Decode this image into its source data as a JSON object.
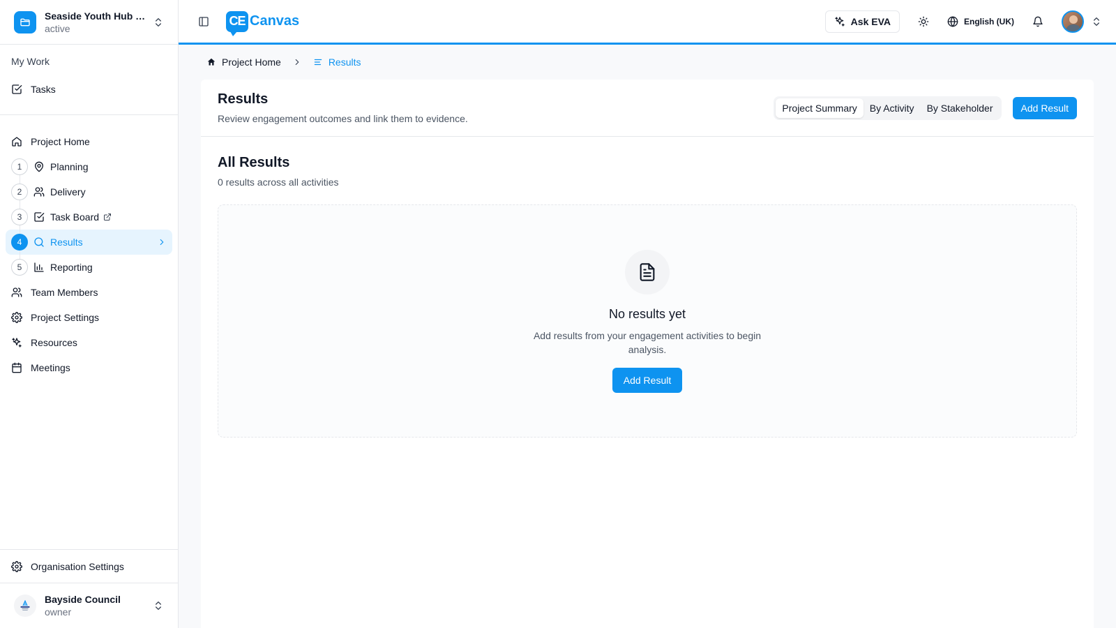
{
  "project": {
    "name": "Seaside Youth Hub – ...",
    "status": "active"
  },
  "my_work": {
    "title": "My Work",
    "tasks_label": "Tasks"
  },
  "nav": {
    "project_home": "Project Home",
    "steps": [
      {
        "num": "1",
        "label": "Planning",
        "icon": "map-pin-icon"
      },
      {
        "num": "2",
        "label": "Delivery",
        "icon": "users-icon"
      },
      {
        "num": "3",
        "label": "Task Board",
        "icon": "check-square-icon"
      },
      {
        "num": "4",
        "label": "Results",
        "icon": "search-icon"
      },
      {
        "num": "5",
        "label": "Reporting",
        "icon": "bar-chart-icon"
      }
    ],
    "team_members": "Team Members",
    "project_settings": "Project Settings",
    "resources": "Resources",
    "meetings": "Meetings"
  },
  "org": {
    "settings_label": "Organisation Settings",
    "name": "Bayside Council",
    "role": "owner"
  },
  "topbar": {
    "logo_mark": "CE",
    "logo_text": "Canvas",
    "ask_eva": "Ask EVA",
    "language": "English (UK)"
  },
  "breadcrumb": {
    "home": "Project Home",
    "current": "Results"
  },
  "page": {
    "title": "Results",
    "subtitle": "Review engagement outcomes and link them to evidence.",
    "tabs": [
      "Project Summary",
      "By Activity",
      "By Stakeholder"
    ],
    "add_result": "Add Result"
  },
  "section": {
    "title": "All Results",
    "subtitle": "0 results across all activities"
  },
  "empty_state": {
    "title": "No results yet",
    "text": "Add results from your engagement activities to begin analysis.",
    "button": "Add Result"
  },
  "colors": {
    "accent": "#0e93f0",
    "active_bg": "#e6f4fe"
  }
}
